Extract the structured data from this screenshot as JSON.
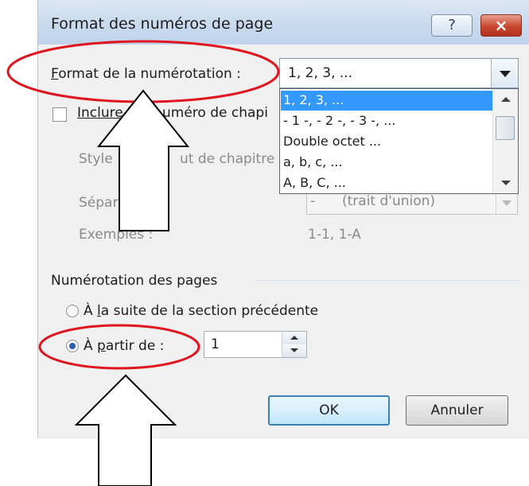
{
  "dialog": {
    "title": "Format des numéros de page",
    "help_button": "?",
    "close_button": "×"
  },
  "number_format": {
    "label_accel": "F",
    "label_rest": "ormat de la numérotation :",
    "value": "1, 2, 3, ...",
    "options": [
      "1, 2, 3, ...",
      "- 1 -, - 2 -, - 3 -, ...",
      "Double octet ...",
      "a, b, c, ...",
      "A, B, C, ..."
    ]
  },
  "chapter": {
    "include_label_a": "Inclure l",
    "include_label_b": "uméro de chapi",
    "style_label_a": "Style",
    "style_label_b": "ut de chapitre",
    "separator_label": "Sépar",
    "separator_value": "(trait d'union)",
    "separator_dash": "-",
    "examples_label": "Exemples :",
    "examples_value": "1-1, 1-A"
  },
  "page_numbering": {
    "section_label": "Numérotation des pages",
    "continue_pre": "À ",
    "continue_accel": "l",
    "continue_post": "a suite de la section précédente",
    "start_pre": "À ",
    "start_accel": "p",
    "start_post": "artir de :",
    "start_value": "1",
    "selected": "start_at"
  },
  "buttons": {
    "ok": "OK",
    "cancel": "Annuler"
  },
  "colors": {
    "highlight": "#3399ff",
    "annotation": "#e0141e"
  }
}
